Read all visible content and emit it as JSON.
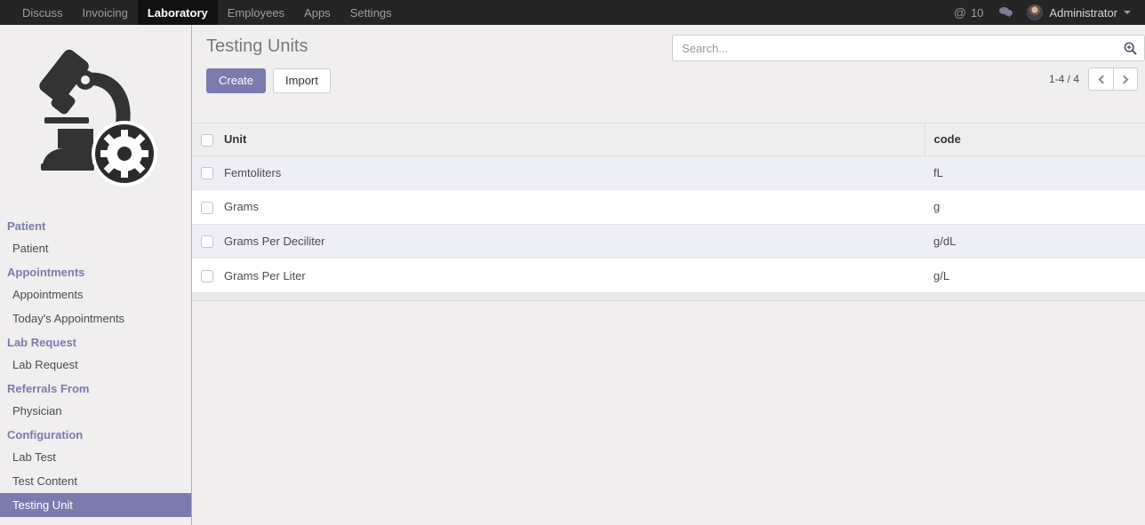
{
  "navbar": {
    "menu": [
      {
        "label": "Discuss",
        "active": false
      },
      {
        "label": "Invoicing",
        "active": false
      },
      {
        "label": "Laboratory",
        "active": true
      },
      {
        "label": "Employees",
        "active": false
      },
      {
        "label": "Apps",
        "active": false
      },
      {
        "label": "Settings",
        "active": false
      }
    ],
    "mentions_icon": "at-icon",
    "mentions_count": "10",
    "messages_icon": "chat-bubble-icon",
    "user_name": "Administrator",
    "user_avatar_icon": "avatar",
    "user_caret_icon": "caret-down-icon"
  },
  "sidebar": {
    "logo_icon": "microscope-gear-icon",
    "sections": [
      {
        "title": "Patient",
        "items": [
          {
            "label": "Patient",
            "active": false
          }
        ]
      },
      {
        "title": "Appointments",
        "items": [
          {
            "label": "Appointments",
            "active": false
          },
          {
            "label": "Today's Appointments",
            "active": false
          }
        ]
      },
      {
        "title": "Lab Request",
        "items": [
          {
            "label": "Lab Request",
            "active": false
          }
        ]
      },
      {
        "title": "Referrals From",
        "items": [
          {
            "label": "Physician",
            "active": false
          }
        ]
      },
      {
        "title": "Configuration",
        "items": [
          {
            "label": "Lab Test",
            "active": false
          },
          {
            "label": "Test Content",
            "active": false
          },
          {
            "label": "Testing Unit",
            "active": true
          }
        ]
      }
    ]
  },
  "main": {
    "title": "Testing Units",
    "buttons": {
      "create": "Create",
      "import": "Import"
    },
    "search": {
      "placeholder": "Search...",
      "value": "",
      "icon": "search-zoom-icon"
    },
    "pager": {
      "label": "1-4 / 4",
      "prev_icon": "chevron-left-icon",
      "next_icon": "chevron-right-icon"
    },
    "table": {
      "columns": [
        "Unit",
        "code"
      ],
      "rows": [
        {
          "unit": "Femtoliters",
          "code": "fL"
        },
        {
          "unit": "Grams",
          "code": "g"
        },
        {
          "unit": "Grams Per Deciliter",
          "code": "g/dL"
        },
        {
          "unit": "Grams Per Liter",
          "code": "g/L"
        }
      ]
    }
  },
  "colors": {
    "accent": "#7C7BAD",
    "navbar_bg": "#252525",
    "navbar_active_bg": "#111111",
    "page_bg": "#F0EEEE",
    "row_odd": "#EEEEF6",
    "row_even": "#FFFFFF"
  }
}
